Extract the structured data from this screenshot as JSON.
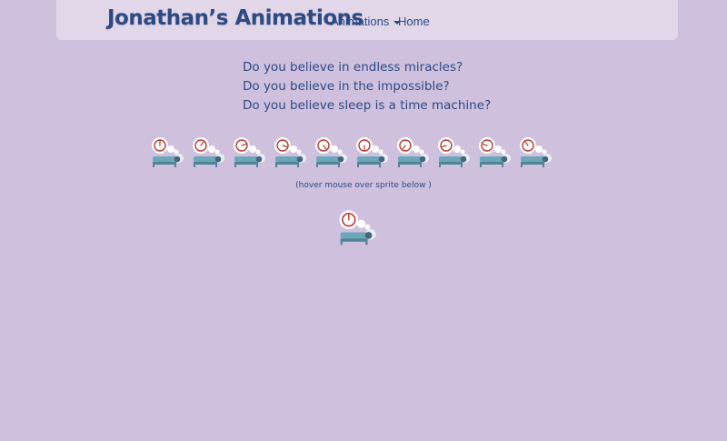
{
  "navbar": {
    "brand": "Jonathan’s Animations",
    "menu_animations": "Animations",
    "menu_home": "Home"
  },
  "poem": {
    "lines": [
      "Do you believe in endless miracles?",
      "Do you believe in the impossible?",
      "Do you believe sleep is a time machine?"
    ]
  },
  "sprites": {
    "frame_count": 10,
    "hint": "(hover mouse over sprite below )"
  },
  "colors": {
    "background": "#cfc0de",
    "navbar": "#e2d6e9",
    "text": "#2d4a84",
    "clock_face": "#ffffff",
    "clock_rim": "#c0392b",
    "bed": "#6aa7b8"
  },
  "icons": [
    "sleep-clock-sprite-icon",
    "caret-down-icon"
  ]
}
